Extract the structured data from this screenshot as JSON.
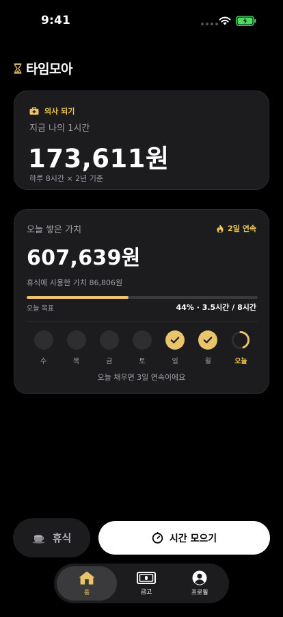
{
  "status_bar": {
    "time": "9:41"
  },
  "app": {
    "title": "타임모아"
  },
  "hourly_card": {
    "goal_tag": "의사 되기",
    "caption": "지금 나의 1시간",
    "value": "173,611원",
    "basis": "하루 8시간 × 2년 기준"
  },
  "today_card": {
    "caption": "오늘 쌓은 가치",
    "streak": "2일 연속",
    "value": "607,639원",
    "rest_value": "휴식에 사용한 가치 86,806원",
    "goal_label": "오늘 목표",
    "goal_progress": "44% · 3.5시간 / 8시간",
    "progress": 0.44,
    "days": [
      {
        "label": "수",
        "state": "empty"
      },
      {
        "label": "목",
        "state": "empty"
      },
      {
        "label": "금",
        "state": "empty"
      },
      {
        "label": "토",
        "state": "empty"
      },
      {
        "label": "일",
        "state": "done"
      },
      {
        "label": "월",
        "state": "done"
      },
      {
        "label": "오늘",
        "state": "today"
      }
    ],
    "streak_message": "오늘 채우면 3일 연속이에요"
  },
  "actions": {
    "rest_label": "휴식",
    "collect_label": "시간 모으기"
  },
  "tabs": [
    {
      "label": "홈",
      "icon": "home-icon",
      "active": true
    },
    {
      "label": "금고",
      "icon": "vault-icon",
      "active": false
    },
    {
      "label": "프로필",
      "icon": "profile-icon",
      "active": false
    }
  ],
  "colors": {
    "accent": "#e9c46a",
    "card": "#1c1c1e",
    "background": "#000000"
  }
}
